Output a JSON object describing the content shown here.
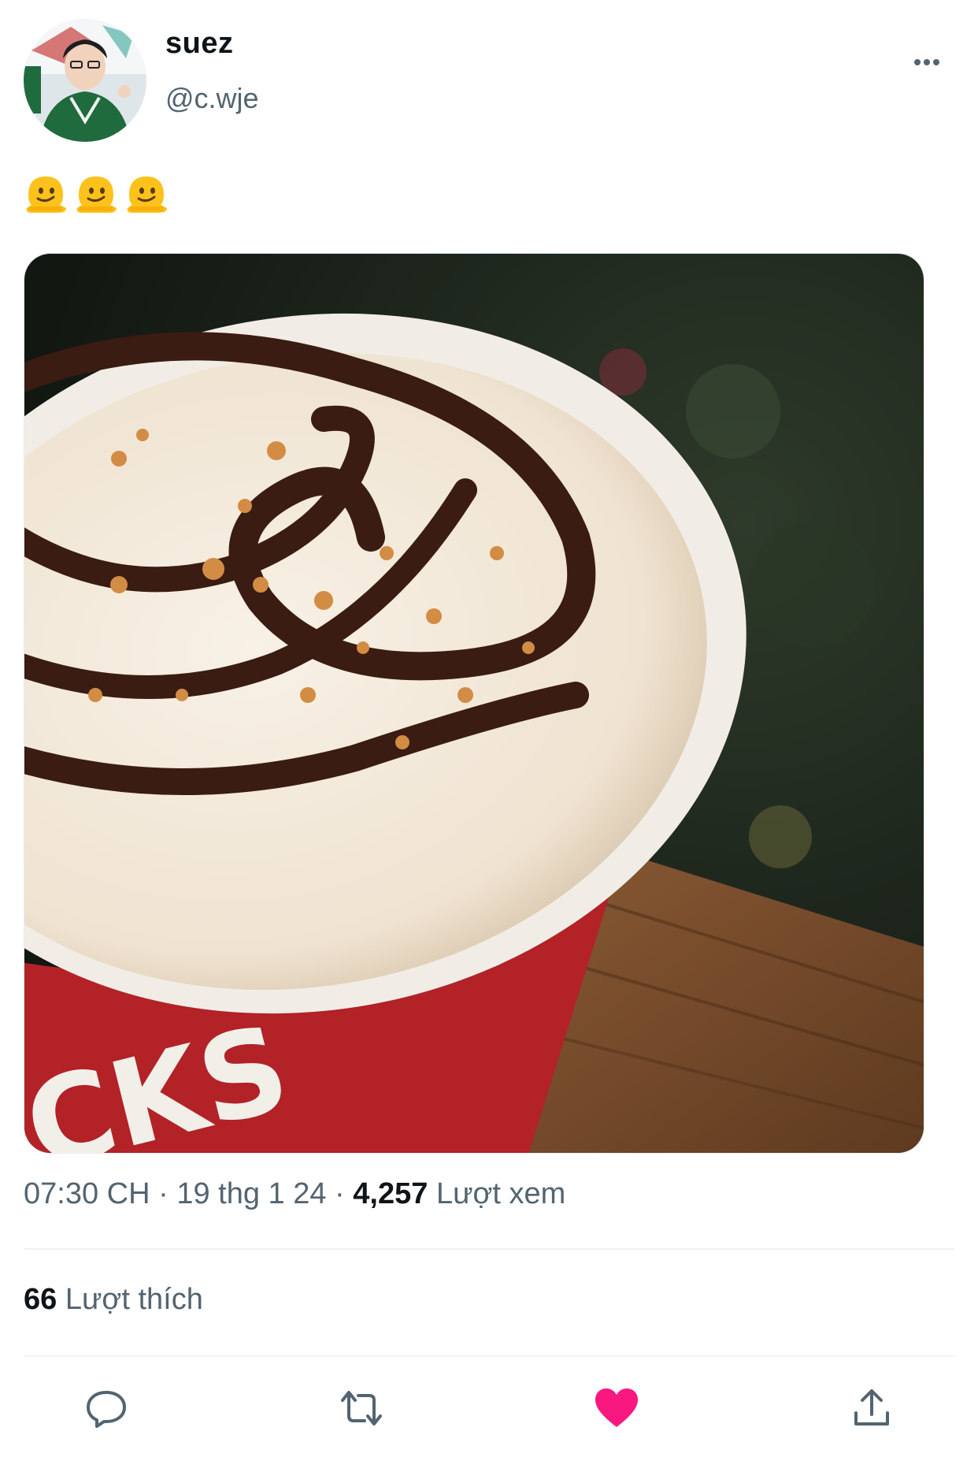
{
  "author": {
    "display_name": "suez",
    "handle": "@c.wje"
  },
  "tweet": {
    "emojis": [
      "melting-face-emoji",
      "melting-face-emoji",
      "melting-face-emoji"
    ]
  },
  "meta": {
    "time": "07:30 CH",
    "sep1": " · ",
    "date": "19 thg 1 24",
    "sep2": " · ",
    "views_count": "4,257",
    "views_label": "Lượt xem"
  },
  "engagement": {
    "likes_count": "66",
    "likes_label": "Lượt thích"
  },
  "actions": {
    "reply_icon": "reply-icon",
    "retweet_icon": "retweet-icon",
    "like_icon": "heart-filled-icon",
    "share_icon": "share-icon"
  },
  "colors": {
    "text_primary": "#0f1419",
    "text_secondary": "#536471",
    "like_active": "#f91880",
    "icon_gray": "#536471",
    "divider": "#eff3f4"
  }
}
